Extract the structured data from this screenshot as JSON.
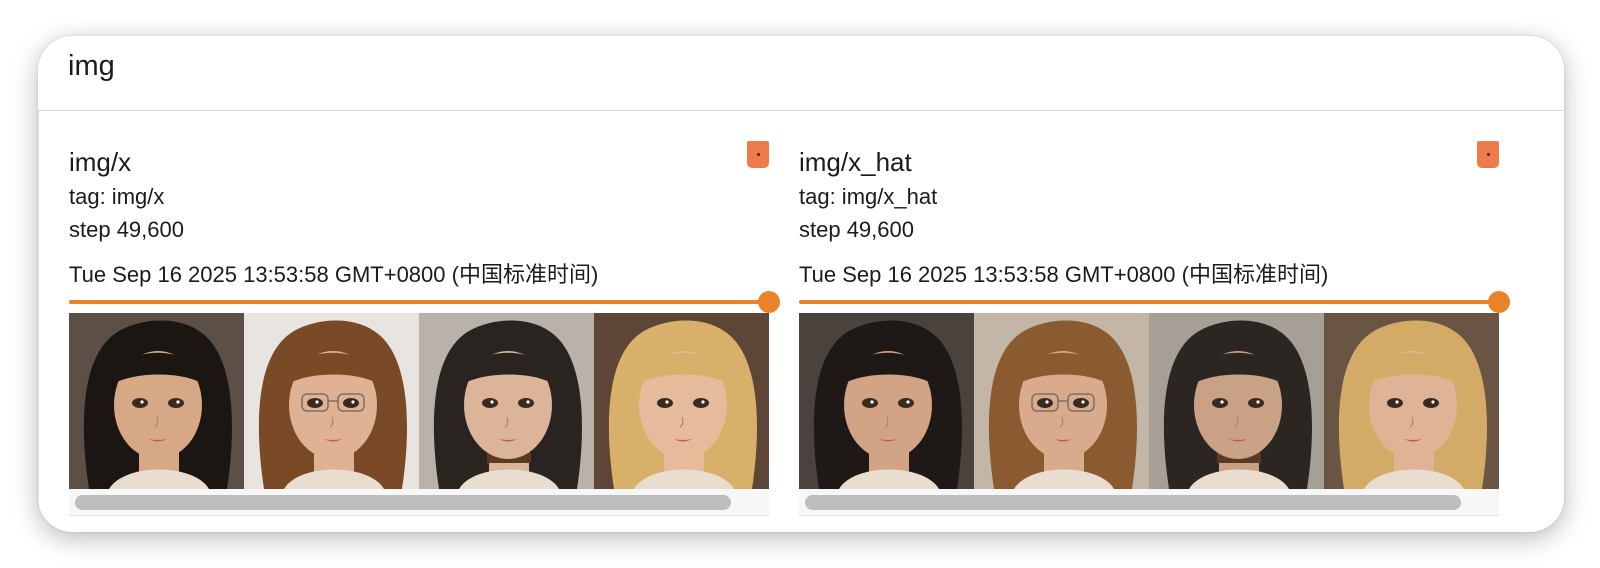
{
  "header": {
    "title": "img"
  },
  "colors": {
    "accent": "#e8832a",
    "pin": "#ef7a4a",
    "text": "#1b1b1b"
  },
  "cards": [
    {
      "title": "img/x",
      "tag": "tag: img/x",
      "step": "step 49,600",
      "time": "Tue Sep 16 2025 13:53:58 GMT+0800 (中国标准时间)",
      "step_slider_fraction": 1.0,
      "images": [
        {
          "hair": "#1c1612",
          "skin": "#d7a886",
          "bg": "#5b4f46",
          "glasses": false,
          "choker": false
        },
        {
          "hair": "#7a4a26",
          "skin": "#e0b294",
          "bg": "#e8e4df",
          "glasses": true,
          "choker": false
        },
        {
          "hair": "#2a2420",
          "skin": "#dcb49a",
          "bg": "#b8b2aa",
          "glasses": false,
          "choker": true
        },
        {
          "hair": "#d9b06a",
          "skin": "#e6bb9c",
          "bg": "#5e4636",
          "glasses": false,
          "choker": false
        }
      ]
    },
    {
      "title": "img/x_hat",
      "tag": "tag: img/x_hat",
      "step": "step 49,600",
      "time": "Tue Sep 16 2025 13:53:58 GMT+0800 (中国标准时间)",
      "step_slider_fraction": 1.0,
      "images": [
        {
          "hair": "#1e1916",
          "skin": "#d2a384",
          "bg": "#4a423c",
          "glasses": false,
          "choker": false
        },
        {
          "hair": "#8a5a30",
          "skin": "#d9ab8c",
          "bg": "#c4b6a6",
          "glasses": true,
          "choker": false
        },
        {
          "hair": "#2c2622",
          "skin": "#c9a286",
          "bg": "#a59f95",
          "glasses": false,
          "choker": true
        },
        {
          "hair": "#d4ab66",
          "skin": "#dfb496",
          "bg": "#6a5444",
          "glasses": false,
          "choker": false
        }
      ]
    }
  ]
}
